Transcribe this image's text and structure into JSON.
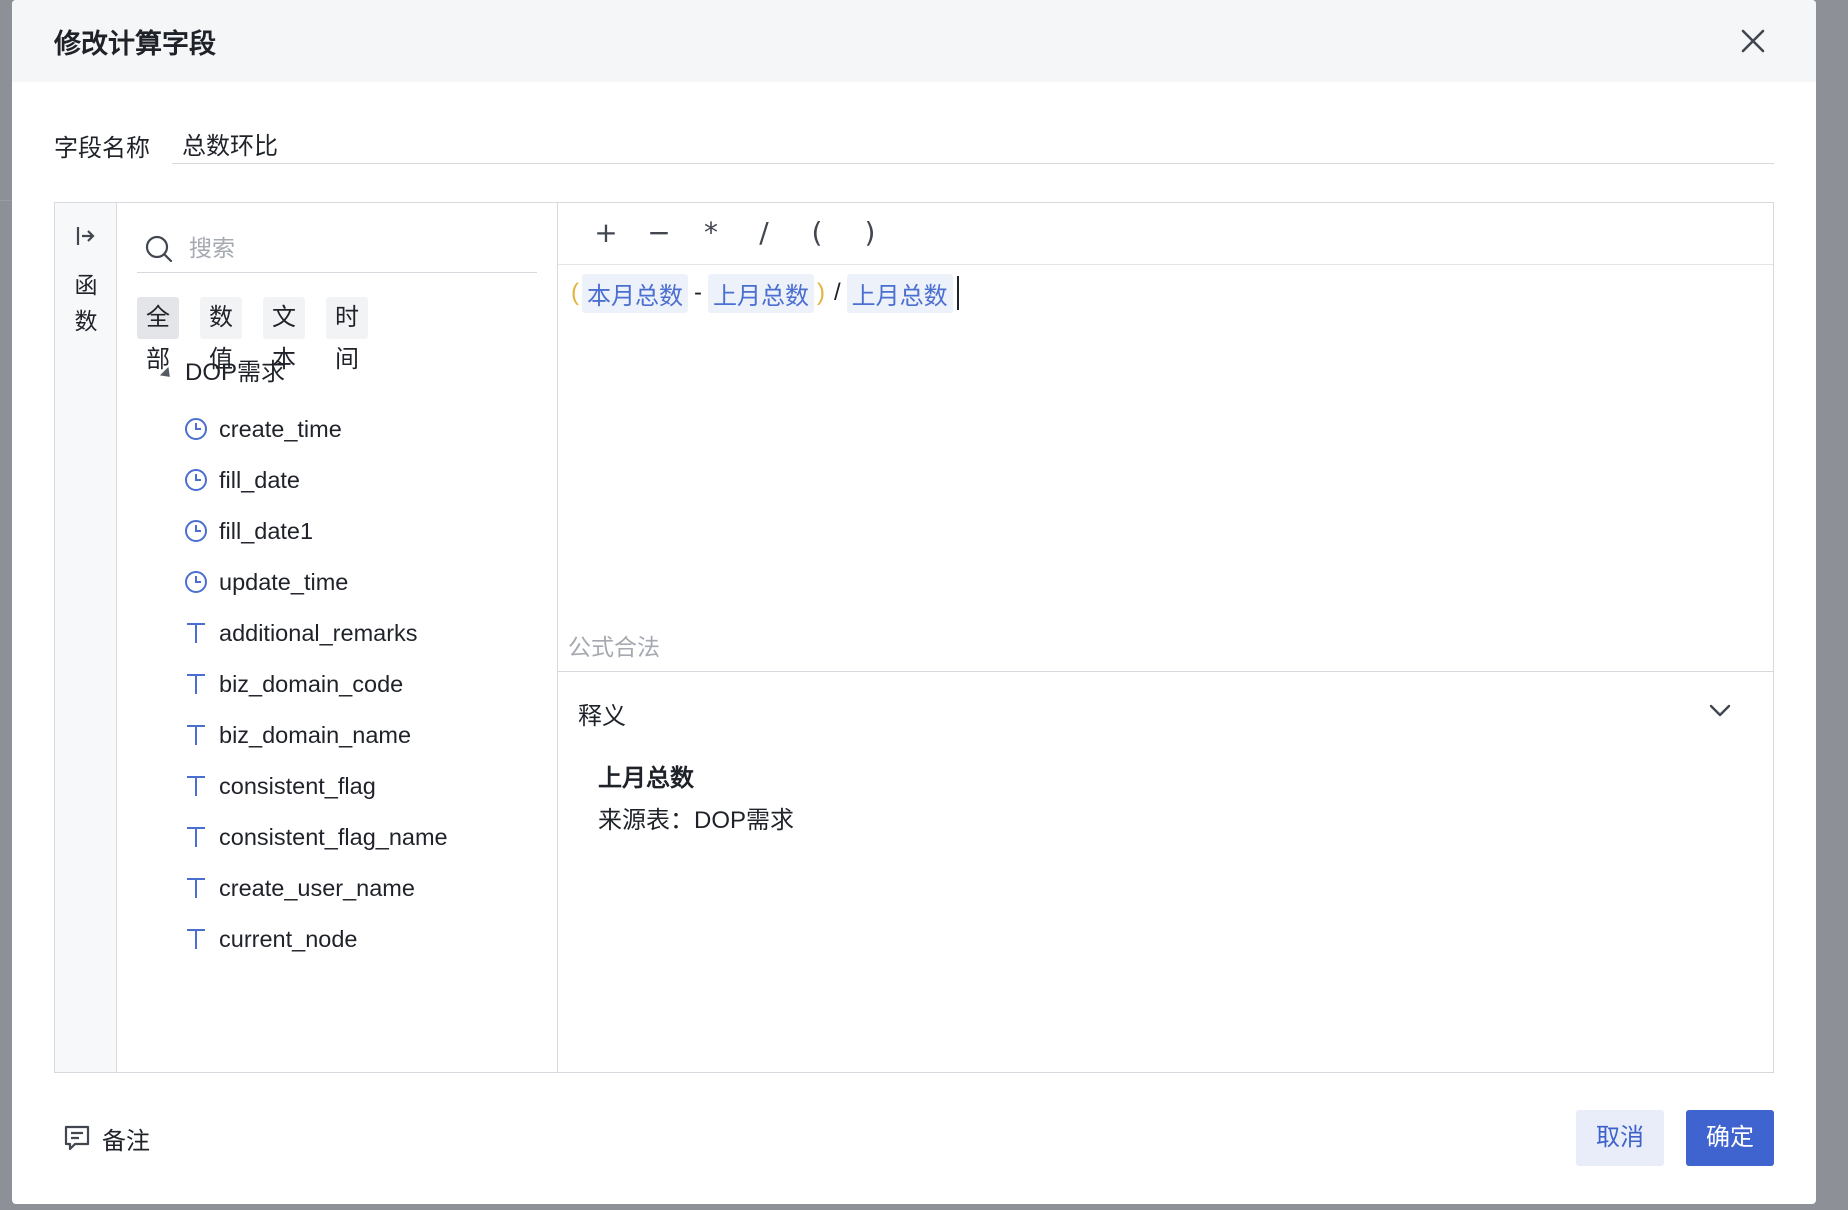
{
  "dialog": {
    "title": "修改计算字段",
    "close_label": "close"
  },
  "field_name": {
    "label": "字段名称",
    "value": "总数环比"
  },
  "function_rail": {
    "label_line1": "函",
    "label_line2": "数"
  },
  "search": {
    "placeholder": "搜索"
  },
  "type_tabs": [
    {
      "label": "全部",
      "active": true
    },
    {
      "label": "数值",
      "active": false
    },
    {
      "label": "文本",
      "active": false
    },
    {
      "label": "时间",
      "active": false
    }
  ],
  "field_tree": {
    "group_label": "DOP需求",
    "items": [
      {
        "name": "create_time",
        "icon": "clock-icon"
      },
      {
        "name": "fill_date",
        "icon": "clock-icon"
      },
      {
        "name": "fill_date1",
        "icon": "clock-icon"
      },
      {
        "name": "update_time",
        "icon": "clock-icon"
      },
      {
        "name": "additional_remarks",
        "icon": "text-icon"
      },
      {
        "name": "biz_domain_code",
        "icon": "text-icon"
      },
      {
        "name": "biz_domain_name",
        "icon": "text-icon"
      },
      {
        "name": "consistent_flag",
        "icon": "text-icon"
      },
      {
        "name": "consistent_flag_name",
        "icon": "text-icon"
      },
      {
        "name": "create_user_name",
        "icon": "text-icon"
      },
      {
        "name": "current_node",
        "icon": "text-icon"
      }
    ]
  },
  "operators": [
    "+",
    "−",
    "*",
    "/",
    "(",
    ")"
  ],
  "formula": {
    "open_paren": "(",
    "token1": "本月总数",
    "op1": "-",
    "token2": "上月总数",
    "close_paren": ")",
    "op2": "/",
    "token3": "上月总数",
    "status": "公式合法"
  },
  "explanation": {
    "title": "释义",
    "field_name": "上月总数",
    "source": "来源表：DOP需求"
  },
  "footer": {
    "note_label": "备注",
    "cancel_label": "取消",
    "ok_label": "确定"
  },
  "colors": {
    "primary": "#3f63cf",
    "token_bg": "#edf1fa",
    "token_text": "#4a6fd0",
    "paren": "#e0b33a"
  }
}
